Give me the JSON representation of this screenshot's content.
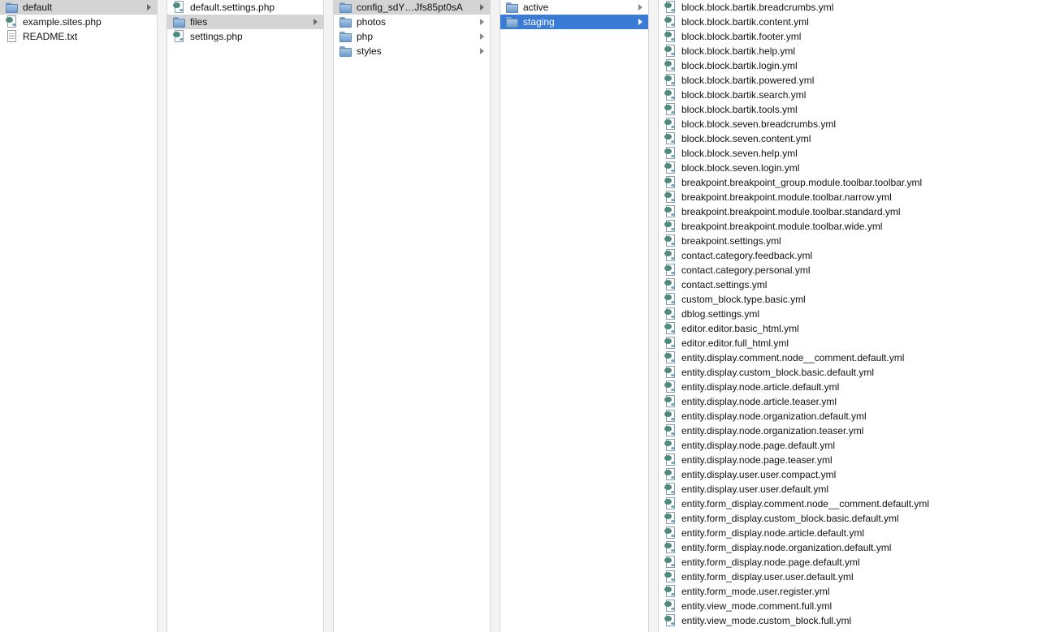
{
  "columns": [
    {
      "items": [
        {
          "label": "default",
          "icon": "folder-icon",
          "state": "sel-inactive",
          "arrow": true
        },
        {
          "label": "example.sites.php",
          "icon": "script-icon",
          "state": "",
          "arrow": false
        },
        {
          "label": "README.txt",
          "icon": "doc-icon",
          "state": "",
          "arrow": false
        }
      ]
    },
    {
      "items": [
        {
          "label": "default.settings.php",
          "icon": "script-icon",
          "state": "",
          "arrow": false
        },
        {
          "label": "files",
          "icon": "folder-icon",
          "state": "sel-inactive",
          "arrow": true
        },
        {
          "label": "settings.php",
          "icon": "script-icon",
          "state": "",
          "arrow": false
        }
      ]
    },
    {
      "items": [
        {
          "label": "config_sdY…Jfs85pt0sA",
          "icon": "folder-icon",
          "state": "sel-inactive",
          "arrow": true
        },
        {
          "label": "photos",
          "icon": "folder-icon",
          "state": "",
          "arrow": true
        },
        {
          "label": "php",
          "icon": "folder-icon",
          "state": "",
          "arrow": true
        },
        {
          "label": "styles",
          "icon": "folder-icon",
          "state": "",
          "arrow": true
        }
      ]
    },
    {
      "items": [
        {
          "label": "active",
          "icon": "folder-icon",
          "state": "",
          "arrow": true
        },
        {
          "label": "staging",
          "icon": "folder-icon",
          "state": "sel-active",
          "arrow": true
        }
      ]
    },
    {
      "items": [
        {
          "label": "block.block.bartik.breadcrumbs.yml",
          "icon": "script-icon",
          "state": "",
          "arrow": false
        },
        {
          "label": "block.block.bartik.content.yml",
          "icon": "script-icon",
          "state": "",
          "arrow": false
        },
        {
          "label": "block.block.bartik.footer.yml",
          "icon": "script-icon",
          "state": "",
          "arrow": false
        },
        {
          "label": "block.block.bartik.help.yml",
          "icon": "script-icon",
          "state": "",
          "arrow": false
        },
        {
          "label": "block.block.bartik.login.yml",
          "icon": "script-icon",
          "state": "",
          "arrow": false
        },
        {
          "label": "block.block.bartik.powered.yml",
          "icon": "script-icon",
          "state": "",
          "arrow": false
        },
        {
          "label": "block.block.bartik.search.yml",
          "icon": "script-icon",
          "state": "",
          "arrow": false
        },
        {
          "label": "block.block.bartik.tools.yml",
          "icon": "script-icon",
          "state": "",
          "arrow": false
        },
        {
          "label": "block.block.seven.breadcrumbs.yml",
          "icon": "script-icon",
          "state": "",
          "arrow": false
        },
        {
          "label": "block.block.seven.content.yml",
          "icon": "script-icon",
          "state": "",
          "arrow": false
        },
        {
          "label": "block.block.seven.help.yml",
          "icon": "script-icon",
          "state": "",
          "arrow": false
        },
        {
          "label": "block.block.seven.login.yml",
          "icon": "script-icon",
          "state": "",
          "arrow": false
        },
        {
          "label": "breakpoint.breakpoint_group.module.toolbar.toolbar.yml",
          "icon": "script-icon",
          "state": "",
          "arrow": false
        },
        {
          "label": "breakpoint.breakpoint.module.toolbar.narrow.yml",
          "icon": "script-icon",
          "state": "",
          "arrow": false
        },
        {
          "label": "breakpoint.breakpoint.module.toolbar.standard.yml",
          "icon": "script-icon",
          "state": "",
          "arrow": false
        },
        {
          "label": "breakpoint.breakpoint.module.toolbar.wide.yml",
          "icon": "script-icon",
          "state": "",
          "arrow": false
        },
        {
          "label": "breakpoint.settings.yml",
          "icon": "script-icon",
          "state": "",
          "arrow": false
        },
        {
          "label": "contact.category.feedback.yml",
          "icon": "script-icon",
          "state": "",
          "arrow": false
        },
        {
          "label": "contact.category.personal.yml",
          "icon": "script-icon",
          "state": "",
          "arrow": false
        },
        {
          "label": "contact.settings.yml",
          "icon": "script-icon",
          "state": "",
          "arrow": false
        },
        {
          "label": "custom_block.type.basic.yml",
          "icon": "script-icon",
          "state": "",
          "arrow": false
        },
        {
          "label": "dblog.settings.yml",
          "icon": "script-icon",
          "state": "",
          "arrow": false
        },
        {
          "label": "editor.editor.basic_html.yml",
          "icon": "script-icon",
          "state": "",
          "arrow": false
        },
        {
          "label": "editor.editor.full_html.yml",
          "icon": "script-icon",
          "state": "",
          "arrow": false
        },
        {
          "label": "entity.display.comment.node__comment.default.yml",
          "icon": "script-icon",
          "state": "",
          "arrow": false
        },
        {
          "label": "entity.display.custom_block.basic.default.yml",
          "icon": "script-icon",
          "state": "",
          "arrow": false
        },
        {
          "label": "entity.display.node.article.default.yml",
          "icon": "script-icon",
          "state": "",
          "arrow": false
        },
        {
          "label": "entity.display.node.article.teaser.yml",
          "icon": "script-icon",
          "state": "",
          "arrow": false
        },
        {
          "label": "entity.display.node.organization.default.yml",
          "icon": "script-icon",
          "state": "",
          "arrow": false
        },
        {
          "label": "entity.display.node.organization.teaser.yml",
          "icon": "script-icon",
          "state": "",
          "arrow": false
        },
        {
          "label": "entity.display.node.page.default.yml",
          "icon": "script-icon",
          "state": "",
          "arrow": false
        },
        {
          "label": "entity.display.node.page.teaser.yml",
          "icon": "script-icon",
          "state": "",
          "arrow": false
        },
        {
          "label": "entity.display.user.user.compact.yml",
          "icon": "script-icon",
          "state": "",
          "arrow": false
        },
        {
          "label": "entity.display.user.user.default.yml",
          "icon": "script-icon",
          "state": "",
          "arrow": false
        },
        {
          "label": "entity.form_display.comment.node__comment.default.yml",
          "icon": "script-icon",
          "state": "",
          "arrow": false
        },
        {
          "label": "entity.form_display.custom_block.basic.default.yml",
          "icon": "script-icon",
          "state": "",
          "arrow": false
        },
        {
          "label": "entity.form_display.node.article.default.yml",
          "icon": "script-icon",
          "state": "",
          "arrow": false
        },
        {
          "label": "entity.form_display.node.organization.default.yml",
          "icon": "script-icon",
          "state": "",
          "arrow": false
        },
        {
          "label": "entity.form_display.node.page.default.yml",
          "icon": "script-icon",
          "state": "",
          "arrow": false
        },
        {
          "label": "entity.form_display.user.user.default.yml",
          "icon": "script-icon",
          "state": "",
          "arrow": false
        },
        {
          "label": "entity.form_mode.user.register.yml",
          "icon": "script-icon",
          "state": "",
          "arrow": false
        },
        {
          "label": "entity.view_mode.comment.full.yml",
          "icon": "script-icon",
          "state": "",
          "arrow": false
        },
        {
          "label": "entity.view_mode.custom_block.full.yml",
          "icon": "script-icon",
          "state": "",
          "arrow": false
        }
      ]
    }
  ],
  "colors": {
    "selection_active": "#3a7bd5",
    "selection_inactive": "#d4d4d4",
    "divider": "#f3f3f3"
  }
}
